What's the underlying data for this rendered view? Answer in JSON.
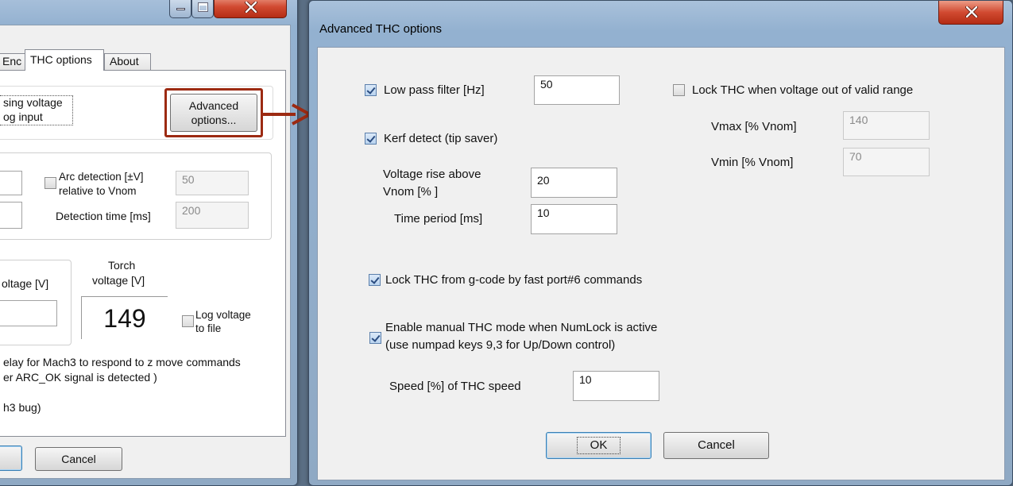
{
  "left_window": {
    "tabs": [
      "Enc",
      "THC options",
      "About"
    ],
    "sensing_label_1": "sing voltage",
    "sensing_label_2": "og input",
    "advanced_button_1": "Advanced",
    "advanced_button_2": "options...",
    "arc_detection_1": "Arc detection [±V]",
    "arc_detection_2": "relative to Vnom",
    "arc_detection_value": "50",
    "detection_time_label": "Detection time [ms]",
    "detection_time_value": "200",
    "voltage_label": "oltage [V]",
    "torch_voltage_1": "Torch",
    "torch_voltage_2": "voltage [V]",
    "torch_voltage_value": "149",
    "log_voltage_1": "Log voltage",
    "log_voltage_2": "to file",
    "delay_text_1": "elay for Mach3 to respond to z move commands",
    "delay_text_2": "er ARC_OK signal is detected )",
    "bug_text": "h3 bug)",
    "cancel_label": "Cancel"
  },
  "dialog": {
    "title": "Advanced THC options",
    "low_pass_label": "Low pass filter [Hz]",
    "low_pass_value": "50",
    "lock_range_label": "Lock THC when voltage out of valid range",
    "vmax_label": "Vmax  [% Vnom]",
    "vmax_value": "140",
    "vmin_label": "Vmin  [% Vnom]",
    "vmin_value": "70",
    "kerf_label": "Kerf detect (tip saver)",
    "voltage_rise_1": "Voltage rise above",
    "voltage_rise_2": "Vnom [% ]",
    "voltage_rise_value": "20",
    "time_period_label": "Time period [ms]",
    "time_period_value": "10",
    "lock_gcode_label": "Lock THC from g-code by fast port#6 commands",
    "manual_mode_1": "Enable manual THC mode when NumLock is active",
    "manual_mode_2": "(use numpad keys 9,3 for Up/Down control)",
    "speed_label": "Speed [%] of THC speed",
    "speed_value": "10",
    "ok_label": "OK",
    "cancel_label": "Cancel"
  },
  "colors": {
    "callout": "#9c2a12",
    "close_button": "#c8432a"
  },
  "icons": {
    "minimize": "minimize-icon",
    "maximize": "maximize-icon",
    "close": "close-icon",
    "arrow": "arrow-right-icon"
  }
}
